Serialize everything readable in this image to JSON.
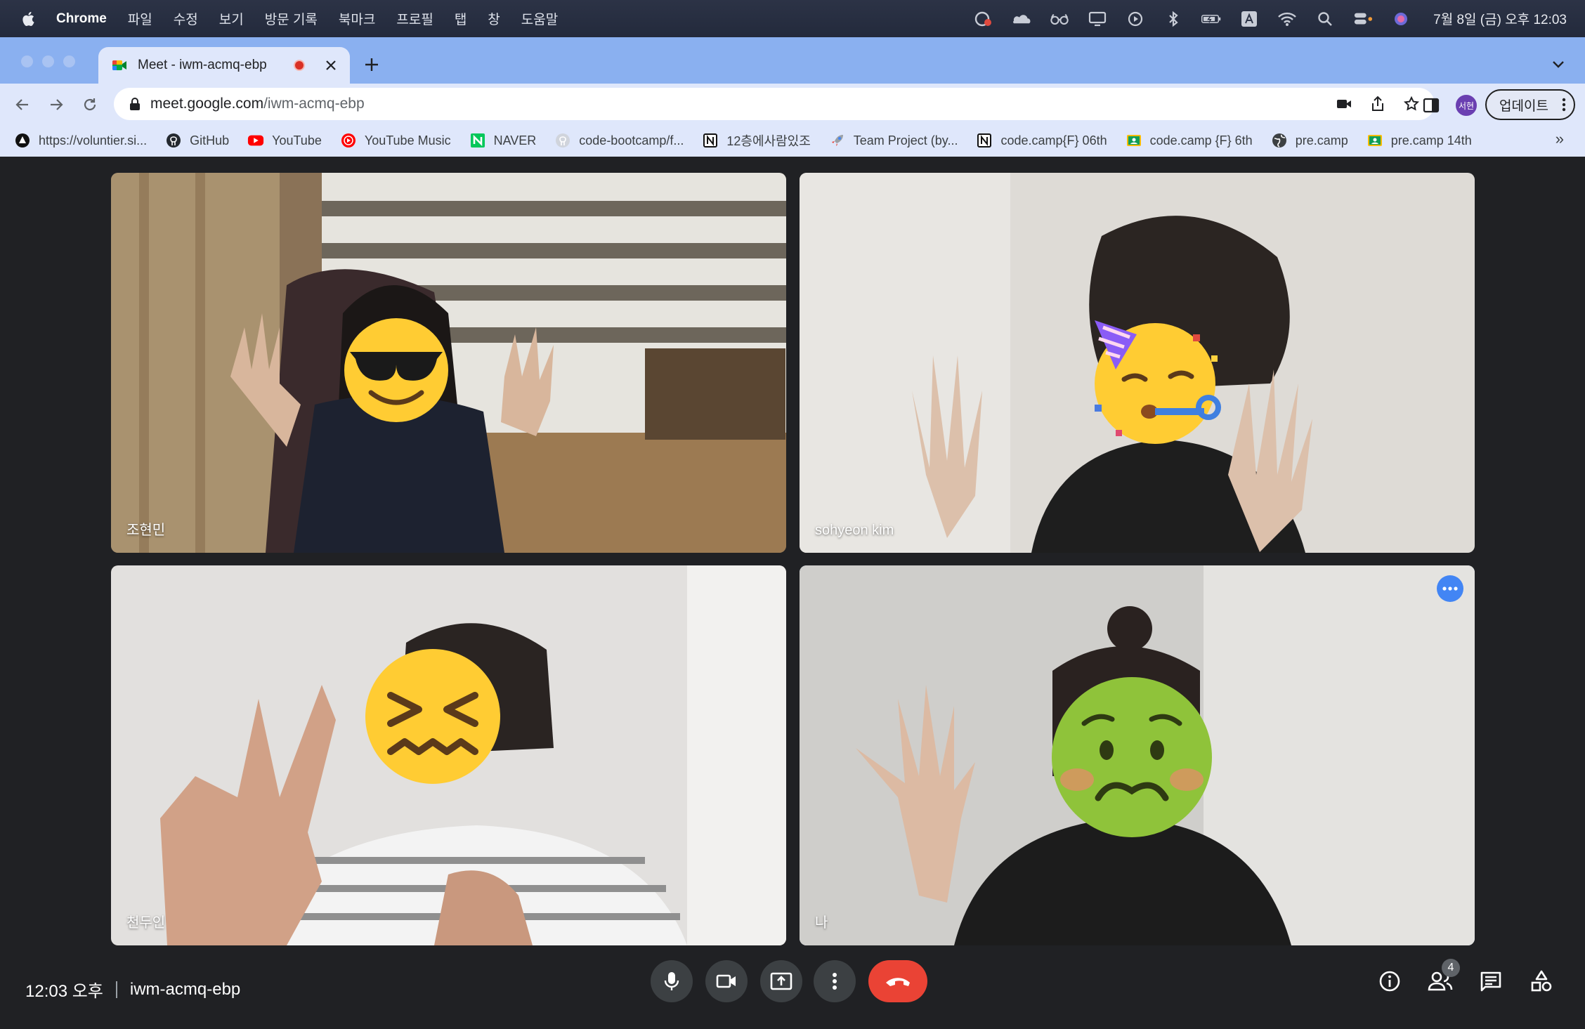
{
  "menubar": {
    "app_name": "Chrome",
    "menus": [
      "파일",
      "수정",
      "보기",
      "방문 기록",
      "북마크",
      "프로필",
      "탭",
      "창",
      "도움말"
    ],
    "clock": "7월 8일 (금) 오후 12:03"
  },
  "browser": {
    "tab_title": "Meet - iwm-acmq-ebp",
    "url_host": "meet.google.com",
    "url_path": "/iwm-acmq-ebp",
    "profile_initials": "서현",
    "update_label": "업데이트",
    "bookmarks": [
      {
        "label": "https://voluntier.si...",
        "icon": "triangle-icon"
      },
      {
        "label": "GitHub",
        "icon": "github-icon"
      },
      {
        "label": "YouTube",
        "icon": "youtube-icon"
      },
      {
        "label": "YouTube Music",
        "icon": "youtube-music-icon"
      },
      {
        "label": "NAVER",
        "icon": "naver-icon"
      },
      {
        "label": "code-bootcamp/f...",
        "icon": "github-icon"
      },
      {
        "label": "12층에사람있조",
        "icon": "notion-icon"
      },
      {
        "label": "Team Project (by...",
        "icon": "rocket-icon"
      },
      {
        "label": "code.camp{F} 06th",
        "icon": "notion-icon"
      },
      {
        "label": "code.camp {F} 6th",
        "icon": "classroom-icon"
      },
      {
        "label": "pre.camp",
        "icon": "globe-icon"
      },
      {
        "label": "pre.camp 14th",
        "icon": "classroom-icon"
      }
    ],
    "bookmarks_more": "»"
  },
  "meet": {
    "participants": [
      {
        "name": "조현민",
        "emoji": "smiling-face-with-sunglasses"
      },
      {
        "name": "sohyeon kim",
        "emoji": "partying-face"
      },
      {
        "name": "천두인",
        "emoji": "confounded-face"
      },
      {
        "name": "나",
        "emoji": "nauseated-face"
      }
    ],
    "time": "12:03 오후",
    "meeting_code": "iwm-acmq-ebp",
    "participant_count": "4"
  },
  "colors": {
    "tabstrip": "#8ab0f0",
    "meet_bg": "#202124",
    "hangup": "#ea4335",
    "active_outline": "#7aa7f2"
  }
}
